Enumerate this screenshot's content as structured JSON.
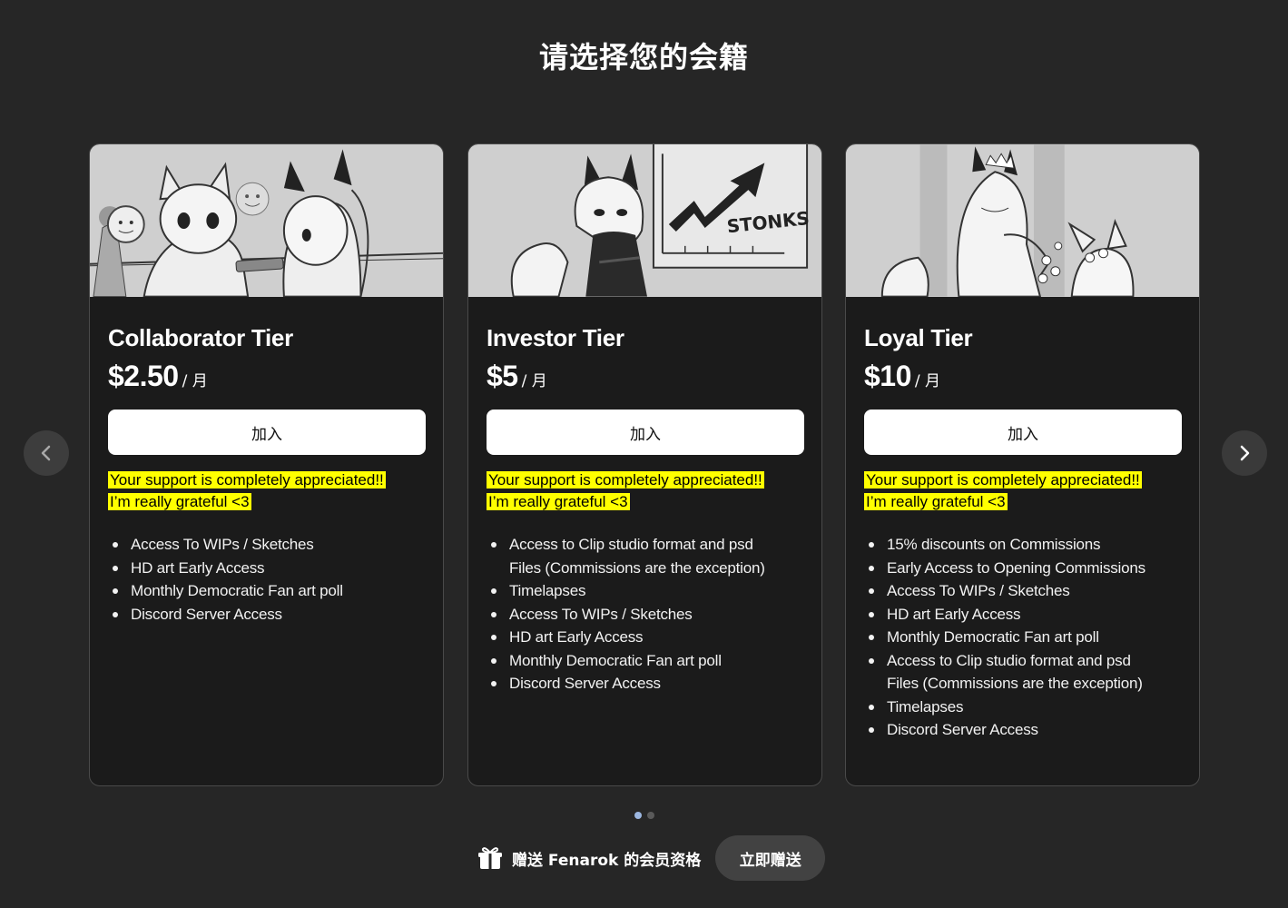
{
  "header": {
    "title": "请选择您的会籍"
  },
  "tiers": [
    {
      "name": "Collaborator Tier",
      "price": "$2.50",
      "per": "/ 月",
      "join_label": "加入",
      "note_lines": [
        "Your support is completely appreciated!!",
        "I’m really grateful <3"
      ],
      "benefits": [
        "Access To WIPs / Sketches",
        "HD art Early Access",
        "Monthly Democratic Fan art poll",
        "Discord Server Access"
      ]
    },
    {
      "name": "Investor Tier",
      "price": "$5",
      "per": "/ 月",
      "join_label": "加入",
      "art_text": "STONKS",
      "note_lines": [
        "Your support is completely appreciated!!",
        "I’m really grateful <3"
      ],
      "benefits": [
        "Access to Clip studio format and psd",
        "Files (Commissions are the exception)",
        "Timelapses",
        "Access To WIPs / Sketches",
        "HD art Early Access",
        "Monthly Democratic Fan art poll",
        "Discord Server Access"
      ]
    },
    {
      "name": "Loyal Tier",
      "price": "$10",
      "per": "/ 月",
      "join_label": "加入",
      "note_lines": [
        "Your support is completely appreciated!!",
        "I’m really grateful <3"
      ],
      "benefits": [
        "15% discounts on Commissions",
        "Early Access to Opening Commissions",
        "Access To WIPs / Sketches",
        "HD art Early Access",
        "Monthly Democratic Fan art poll",
        "Access to Clip studio format and psd",
        "Files (Commissions are the exception)",
        "Timelapses",
        "Discord Server Access"
      ]
    }
  ],
  "carousel": {
    "prev_icon": "chevron-left-icon",
    "next_icon": "chevron-right-icon",
    "active_page": 1,
    "page_count": 2,
    "dot_active_color": "#9bb6e0",
    "dot_inactive_color": "#5a5a5a"
  },
  "gift": {
    "icon": "gift-icon",
    "text": "赠送 Fenarok 的会员资格",
    "button_label": "立即赠送"
  },
  "colors": {
    "background": "#262626",
    "card": "#1b1b1b",
    "highlight": "#ffff00",
    "button": "#ffffff"
  }
}
